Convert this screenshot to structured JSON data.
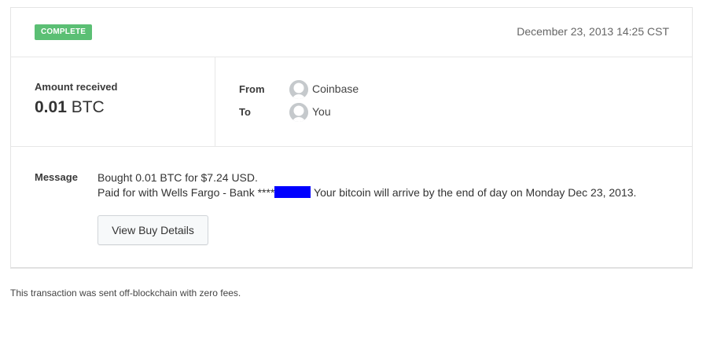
{
  "transaction": {
    "status": "COMPLETE",
    "date": "December 23, 2013 14:25 CST",
    "amount": {
      "label": "Amount received",
      "value": "0.01",
      "currency": "BTC"
    },
    "from": {
      "label": "From",
      "name": "Coinbase"
    },
    "to": {
      "label": "To",
      "name": "You"
    },
    "message": {
      "label": "Message",
      "line1": "Bought 0.01 BTC for $7.24 USD.",
      "line2_before": "Paid for with Wells Fargo - Bank ****",
      "line2_after": " Your bitcoin will arrive by the end of day on Monday Dec 23, 2013."
    },
    "view_button_label": "View Buy Details"
  },
  "footnote": "This transaction was sent off-blockchain with zero fees.",
  "colors": {
    "status_badge": "#5bbf74",
    "redaction": "#0000ff",
    "avatar": "#c5c9cc"
  }
}
